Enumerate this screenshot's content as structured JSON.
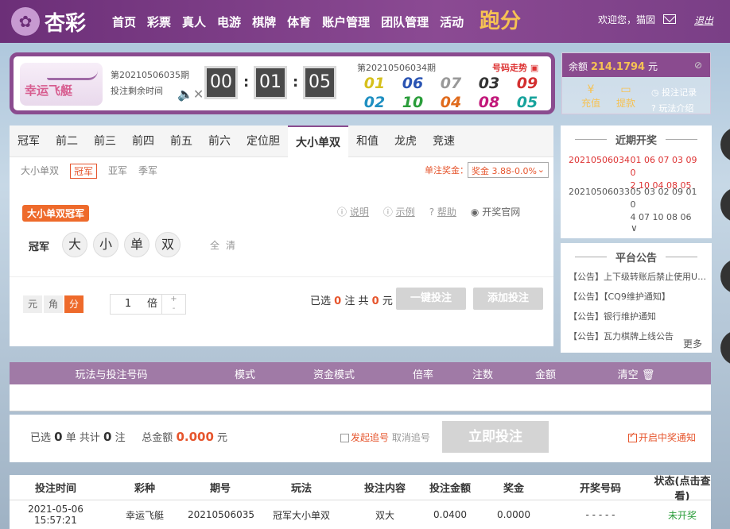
{
  "header": {
    "logo_text": "杏彩",
    "nav": [
      "首页",
      "彩票",
      "真人",
      "电游",
      "棋牌",
      "体育",
      "账户管理",
      "团队管理",
      "活动"
    ],
    "promo": "跑分",
    "welcome": "欢迎您，猫囡",
    "logout": "退出"
  },
  "game": {
    "name": "幸运飞艇",
    "current_issue": "第20210506035期",
    "countdown_label": "投注剩余时间",
    "time": {
      "h": "00",
      "m": "01",
      "s": "05"
    },
    "last_issue": "第20210506034期",
    "trend_link": "号码走势",
    "last_numbers": [
      "01",
      "06",
      "07",
      "03",
      "09",
      "02",
      "10",
      "04",
      "08",
      "05"
    ],
    "number_colors": [
      "#d6c01c",
      "#2a54b3",
      "#999999",
      "#333333",
      "#d32f2f",
      "#1f8fc1",
      "#2a9d3a",
      "#e06b1d",
      "#c2187a",
      "#17a39c"
    ]
  },
  "account": {
    "balance_label": "余额",
    "balance": "214.1794",
    "currency": "元",
    "deposit": "充值",
    "withdraw": "提款",
    "bet_record": "投注记录",
    "rules": "玩法介绍"
  },
  "tabs": [
    "冠军",
    "前二",
    "前三",
    "前四",
    "前五",
    "前六",
    "定位胆",
    "大小单双",
    "和值",
    "龙虎",
    "竞速"
  ],
  "active_tab": "大小单双",
  "subtabs": [
    "大小单双",
    "冠军",
    "亚军",
    "季军"
  ],
  "active_subtab": "冠军",
  "prize_label": "单注奖金：",
  "prize_select": "奖金 3.88-0.0%",
  "play_name": "大小单双冠军",
  "help": [
    "说明",
    "示例",
    "帮助",
    "开奖官网"
  ],
  "row_label": "冠军",
  "choices": [
    "大",
    "小",
    "单",
    "双"
  ],
  "all_clear": [
    "全",
    "清"
  ],
  "units": [
    "元",
    "角",
    "分"
  ],
  "active_unit": "分",
  "multiplier": {
    "value": "1",
    "label": "倍",
    "plus": "+",
    "minus": "-"
  },
  "selection": {
    "prefix": "已选",
    "count": "0",
    "mid": "注  共",
    "amount": "0",
    "suffix": "元"
  },
  "buttons": {
    "quick_bet": "一键投注",
    "add_bet": "添加投注",
    "bet_now": "立即投注"
  },
  "recent": {
    "title": "近期开奖",
    "rows": [
      {
        "issue": "20210506034",
        "nums1": "01 06 07 03 09 0",
        "nums2": "2 10 04 08 05",
        "highlight": true
      },
      {
        "issue": "20210506033",
        "nums1": "05 03 02 09 01 0",
        "nums2": "4 07 10 08 06",
        "highlight": false
      }
    ],
    "expand": "∨"
  },
  "notice": {
    "title": "平台公告",
    "items": [
      "【公告】上下级转账后禁止使用US...",
      "【公告】【CQ9维护通知】",
      "【公告】银行维护通知",
      "【公告】瓦力棋牌上线公告"
    ],
    "more": "更多"
  },
  "cart": {
    "headers": [
      "玩法与投注号码",
      "模式",
      "资金模式",
      "倍率",
      "注数",
      "金额",
      "清空"
    ]
  },
  "totals": {
    "t1": "已选",
    "orders": "0",
    "t2": "单 共计",
    "bets": "0",
    "t3": "注",
    "t4": "总金额",
    "amount": "0.000",
    "t5": "元",
    "chase": "发起追号",
    "cancel_chase": "取消追号",
    "notify": "开启中奖通知"
  },
  "history": {
    "headers": [
      "投注时间",
      "彩种",
      "期号",
      "玩法",
      "投注内容",
      "投注金额",
      "奖金",
      "开奖号码",
      "状态(点击查看)"
    ],
    "row": [
      "2021-05-06 15:57:21",
      "幸运飞艇",
      "20210506035",
      "冠军大小单双",
      "双大",
      "0.0400",
      "0.0000",
      "- - - - -",
      "未开奖"
    ]
  }
}
